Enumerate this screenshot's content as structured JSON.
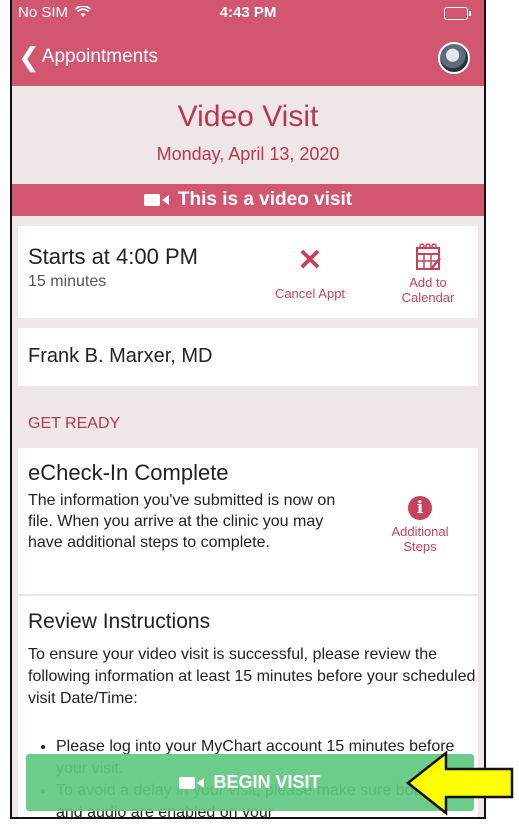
{
  "status_bar": {
    "carrier": "No SIM",
    "time": "4:43 PM"
  },
  "nav": {
    "back_label": "Appointments"
  },
  "visit": {
    "title": "Video Visit",
    "date": "Monday, April 13, 2020",
    "banner": "This is a video visit"
  },
  "appointment": {
    "starts": "Starts at 4:00 PM",
    "duration": "15 minutes",
    "cancel_label": "Cancel Appt",
    "add_calendar_line1": "Add to",
    "add_calendar_line2": "Calendar"
  },
  "provider": {
    "name": "Frank B. Marxer, MD"
  },
  "get_ready": {
    "section_title": "GET READY",
    "echeckin_title": "eCheck-In Complete",
    "echeckin_text": "The information you've submitted is now on file. When you arrive at the clinic you may have additional steps to complete.",
    "additional_line1": "Additional",
    "additional_line2": "Steps"
  },
  "review": {
    "title": "Review Instructions",
    "text": "To ensure your video visit is successful, please review the following information at least 15 minutes before your scheduled visit Date/Time:",
    "items": [
      "Please log into your MyChart account 15 minutes before your visit.",
      "To avoid a delay in your visit, please make sure both video and audio are enabled on your"
    ]
  },
  "begin_visit_label": "BEGIN VISIT",
  "colors": {
    "brand": "#d2566f",
    "accent_text": "#b4394f",
    "begin_button": "#60c880",
    "arrow": "#ffff00"
  },
  "icons": [
    "wifi-icon",
    "battery-icon",
    "back-chevron-icon",
    "avatar",
    "video-camera-icon",
    "close-icon",
    "calendar-icon",
    "info-icon",
    "arrow-annotation"
  ]
}
